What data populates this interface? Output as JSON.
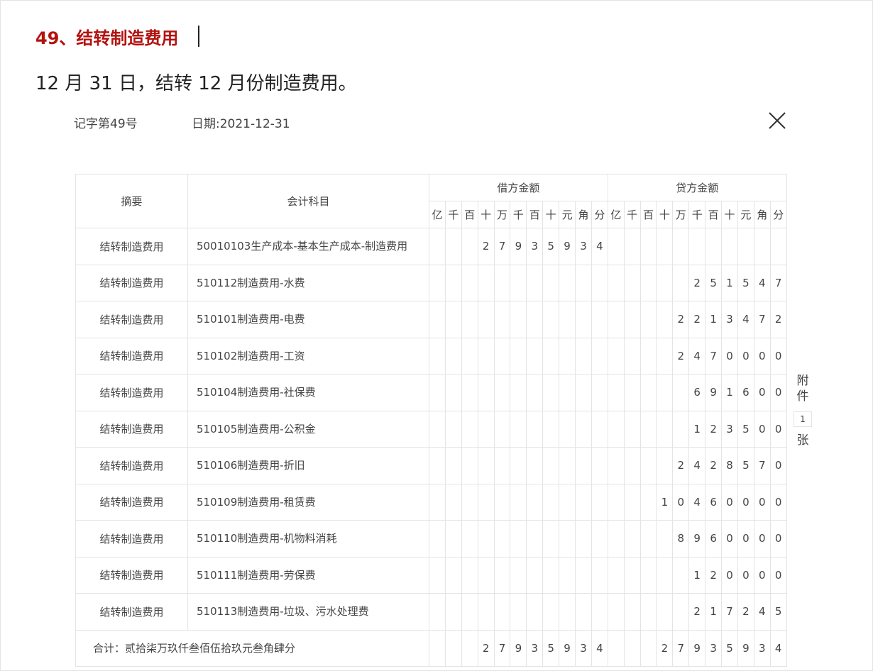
{
  "heading": "49、结转制造费用",
  "intro": "12 月 31 日，结转 12 月份制造费用。",
  "voucher": {
    "number": "记字第49号",
    "date_label": "日期:2021-12-31",
    "headers": {
      "summary": "摘要",
      "account": "会计科目",
      "debit": "借方金额",
      "credit": "贷方金额",
      "digits": [
        "亿",
        "千",
        "百",
        "十",
        "万",
        "千",
        "百",
        "十",
        "元",
        "角",
        "分"
      ]
    },
    "rows": [
      {
        "summary": "结转制造费用",
        "account": "50010103生产成本-基本生产成本-制造费用",
        "debit": [
          "",
          "",
          "",
          "2",
          "7",
          "9",
          "3",
          "5",
          "9",
          "3",
          "4"
        ],
        "credit": [
          "",
          "",
          "",
          "",
          "",
          "",
          "",
          "",
          "",
          "",
          ""
        ]
      },
      {
        "summary": "结转制造费用",
        "account": "510112制造费用-水费",
        "debit": [
          "",
          "",
          "",
          "",
          "",
          "",
          "",
          "",
          "",
          "",
          ""
        ],
        "credit": [
          "",
          "",
          "",
          "",
          "",
          "2",
          "5",
          "1",
          "5",
          "4",
          "7"
        ]
      },
      {
        "summary": "结转制造费用",
        "account": "510101制造费用-电费",
        "debit": [
          "",
          "",
          "",
          "",
          "",
          "",
          "",
          "",
          "",
          "",
          ""
        ],
        "credit": [
          "",
          "",
          "",
          "",
          "2",
          "2",
          "1",
          "3",
          "4",
          "7",
          "2"
        ]
      },
      {
        "summary": "结转制造费用",
        "account": "510102制造费用-工资",
        "debit": [
          "",
          "",
          "",
          "",
          "",
          "",
          "",
          "",
          "",
          "",
          ""
        ],
        "credit": [
          "",
          "",
          "",
          "",
          "2",
          "4",
          "7",
          "0",
          "0",
          "0",
          "0"
        ]
      },
      {
        "summary": "结转制造费用",
        "account": "510104制造费用-社保费",
        "debit": [
          "",
          "",
          "",
          "",
          "",
          "",
          "",
          "",
          "",
          "",
          ""
        ],
        "credit": [
          "",
          "",
          "",
          "",
          "",
          "6",
          "9",
          "1",
          "6",
          "0",
          "0"
        ]
      },
      {
        "summary": "结转制造费用",
        "account": "510105制造费用-公积金",
        "debit": [
          "",
          "",
          "",
          "",
          "",
          "",
          "",
          "",
          "",
          "",
          ""
        ],
        "credit": [
          "",
          "",
          "",
          "",
          "",
          "1",
          "2",
          "3",
          "5",
          "0",
          "0"
        ]
      },
      {
        "summary": "结转制造费用",
        "account": "510106制造费用-折旧",
        "debit": [
          "",
          "",
          "",
          "",
          "",
          "",
          "",
          "",
          "",
          "",
          ""
        ],
        "credit": [
          "",
          "",
          "",
          "",
          "2",
          "4",
          "2",
          "8",
          "5",
          "7",
          "0"
        ]
      },
      {
        "summary": "结转制造费用",
        "account": "510109制造费用-租赁费",
        "debit": [
          "",
          "",
          "",
          "",
          "",
          "",
          "",
          "",
          "",
          "",
          ""
        ],
        "credit": [
          "",
          "",
          "",
          "1",
          "0",
          "4",
          "6",
          "0",
          "0",
          "0",
          "0"
        ]
      },
      {
        "summary": "结转制造费用",
        "account": "510110制造费用-机物料消耗",
        "debit": [
          "",
          "",
          "",
          "",
          "",
          "",
          "",
          "",
          "",
          "",
          ""
        ],
        "credit": [
          "",
          "",
          "",
          "",
          "8",
          "9",
          "6",
          "0",
          "0",
          "0",
          "0"
        ]
      },
      {
        "summary": "结转制造费用",
        "account": "510111制造费用-劳保费",
        "debit": [
          "",
          "",
          "",
          "",
          "",
          "",
          "",
          "",
          "",
          "",
          ""
        ],
        "credit": [
          "",
          "",
          "",
          "",
          "",
          "1",
          "2",
          "0",
          "0",
          "0",
          "0"
        ]
      },
      {
        "summary": "结转制造费用",
        "account": "510113制造费用-垃圾、污水处理费",
        "debit": [
          "",
          "",
          "",
          "",
          "",
          "",
          "",
          "",
          "",
          "",
          ""
        ],
        "credit": [
          "",
          "",
          "",
          "",
          "",
          "2",
          "1",
          "7",
          "2",
          "4",
          "5"
        ]
      }
    ],
    "total": {
      "label": "合计：贰拾柒万玖仟叁佰伍拾玖元叁角肆分",
      "debit": [
        "",
        "",
        "",
        "2",
        "7",
        "9",
        "3",
        "5",
        "9",
        "3",
        "4"
      ],
      "credit": [
        "",
        "",
        "",
        "2",
        "7",
        "9",
        "3",
        "5",
        "9",
        "3",
        "4"
      ]
    },
    "attachments": {
      "label_top": [
        "附",
        "件"
      ],
      "count": "1",
      "label_bottom": "张"
    }
  },
  "colors": {
    "heading": "#b3120f",
    "grid": "#e4e4e4",
    "sep_blue": "#a9c6e8",
    "sep_red": "#e6a3a3"
  }
}
